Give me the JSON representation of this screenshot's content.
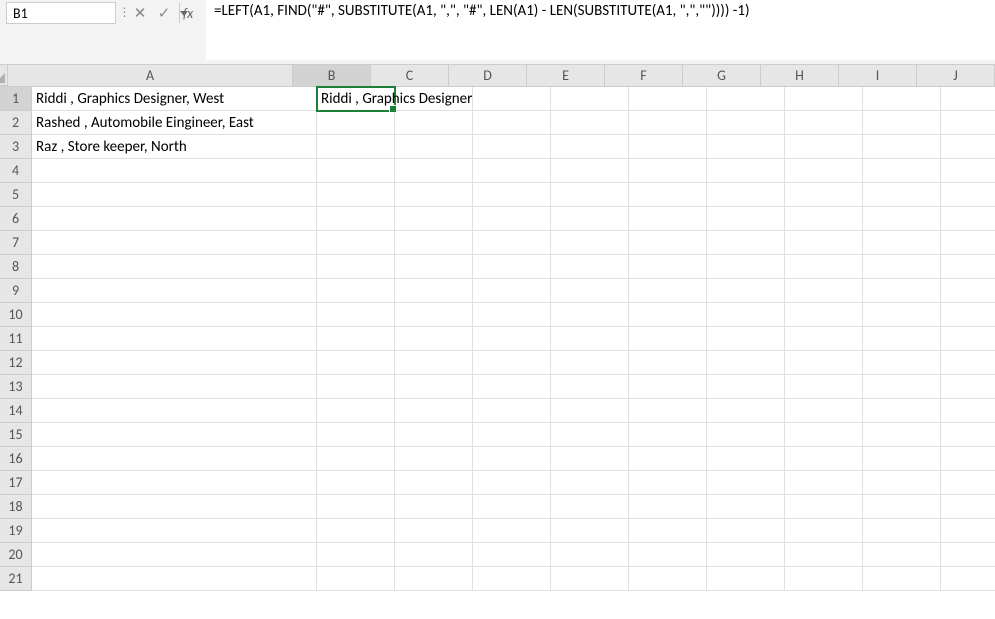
{
  "name_box": "B1",
  "formula": "=LEFT(A1, FIND(\"#\", SUBSTITUTE(A1, \",\", \"#\", LEN(A1) - LEN(SUBSTITUTE(A1, \",\",\"\")))) -1)",
  "columns": [
    "A",
    "B",
    "C",
    "D",
    "E",
    "F",
    "G",
    "H",
    "I",
    "J"
  ],
  "selected_column": "B",
  "selected_row": 1,
  "row_count": 21,
  "cells": {
    "A1": "Riddi  , Graphics Designer, West",
    "A2": "Rashed , Automobile Eingineer, East",
    "A3": "Raz , Store keeper, North",
    "B1": "Riddi  , Graphics Designer"
  },
  "column_widths": {
    "A": 285,
    "B": 78,
    "default": 78
  },
  "active_cell": "B1",
  "icons": {
    "dropdown": "chevron-down",
    "cancel": "✕",
    "enter": "✓"
  },
  "fx_label": "fx"
}
